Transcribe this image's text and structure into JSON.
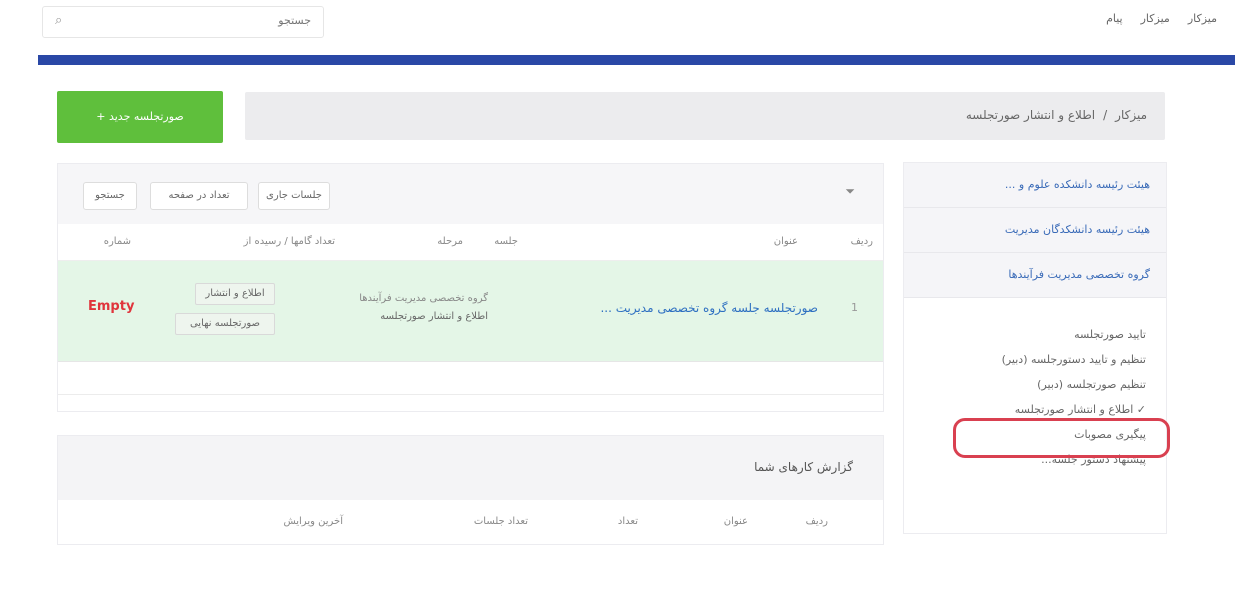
{
  "topbar": {
    "search_placeholder": "جستجو",
    "links": [
      "میزکار",
      "میزکار",
      "پیام"
    ]
  },
  "breadcrumb": {
    "home": "میزکار",
    "separator": "/",
    "current": "اطلاع و انتشار صورتجلسه"
  },
  "new_button": "+ صورتجلسه جدید",
  "sidebar": {
    "categories": [
      "هیئت رئیسه دانشکده علوم و ...",
      "هیئت رئیسه دانشکدگان مدیریت",
      "گروه تخصصی مدیریت فرآیندها"
    ],
    "links": [
      "تایید صورتجلسه",
      "تنظیم و تایید دستورجلسه (دبیر)",
      "تنظیم صورتجلسه (دبیر)",
      "✓ اطلاع و انتشار صورتجلسه",
      "پیگیری مصوبات",
      "پیشنهاد دستور جلسه..."
    ]
  },
  "panel": {
    "buttons": [
      "جلسات جاری",
      "تعداد در صفحه",
      "جستجو"
    ],
    "columns": [
      "ردیف",
      "عنوان",
      "جلسه",
      "مرحله",
      "تعداد گامها / رسیده از",
      "شماره"
    ],
    "rows": [
      {
        "index": "1",
        "title": "صورتجلسه جلسه گروه تخصصی مدیریت ...",
        "session_line1": "گروه تخصصی مدیریت فرآیندها",
        "session_line2": "اطلاع و انتشار صورتجلسه",
        "tag1": "اطلاع و انتشار",
        "tag2": "صورتجلسه نهایی",
        "status": "Empty"
      }
    ]
  },
  "notes": {
    "title": "گزارش کارهای شما",
    "columns": [
      "ردیف",
      "عنوان",
      "تعداد",
      "تعداد جلسات",
      "آخرین ویرایش"
    ]
  },
  "colors": {
    "accent_bar": "#2a48a6",
    "new_button": "#5fbf3c",
    "highlight_ring": "#d94050",
    "row_highlight": "#e4f6e7",
    "status_red": "#e0353c"
  }
}
